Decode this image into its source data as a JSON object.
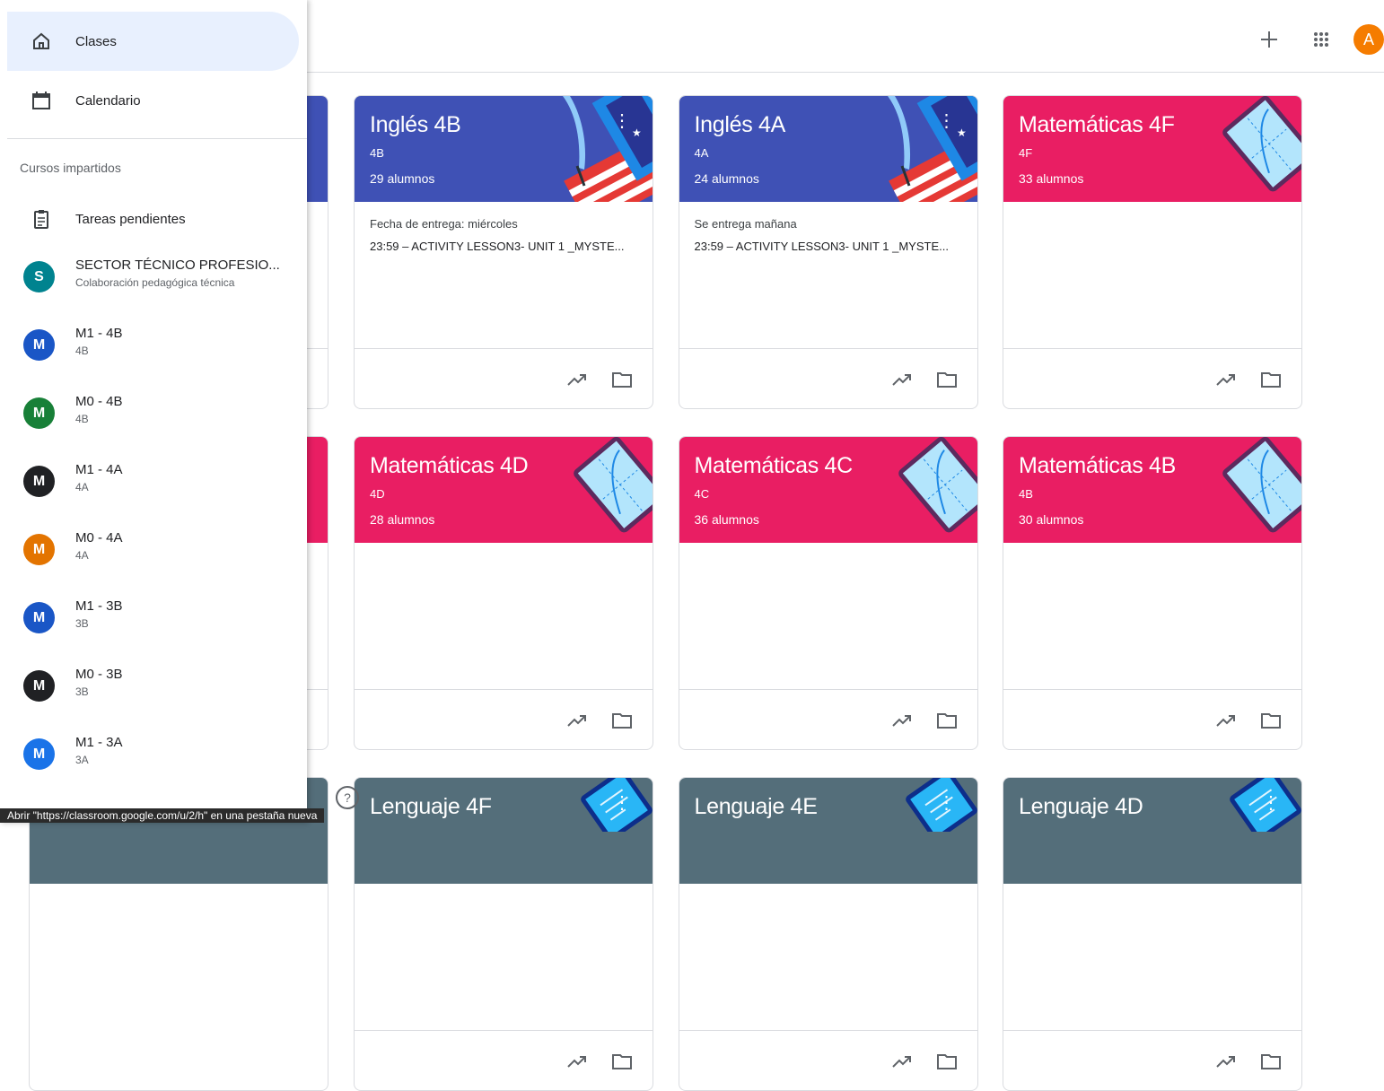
{
  "colors": {
    "indigo": "#3f51b5",
    "pink": "#e91e63",
    "slate": "#546e7a",
    "blue": "#1a56c6",
    "teal": "#00838f",
    "green": "#188038",
    "black": "#202124",
    "orange": "#e37400",
    "brightblue": "#1a73e8"
  },
  "topbar": {
    "add_icon": "plus-icon",
    "apps_icon": "apps-grid-icon",
    "avatar_letter": "A"
  },
  "drawer": {
    "nav": [
      {
        "label": "Clases",
        "icon": "home-icon"
      },
      {
        "label": "Calendario",
        "icon": "calendar-icon"
      }
    ],
    "section_label": "Cursos impartidos",
    "todo_label": "Tareas pendientes",
    "courses": [
      {
        "letter": "S",
        "name": "SECTOR TÉCNICO PROFESIO...",
        "sub": "Colaboración pedagógica técnica",
        "color": "teal"
      },
      {
        "letter": "M",
        "name": "M1 - 4B",
        "sub": "4B",
        "color": "blue"
      },
      {
        "letter": "M",
        "name": "M0 - 4B",
        "sub": "4B",
        "color": "green"
      },
      {
        "letter": "M",
        "name": "M1 - 4A",
        "sub": "4A",
        "color": "black"
      },
      {
        "letter": "M",
        "name": "M0 - 4A",
        "sub": "4A",
        "color": "orange"
      },
      {
        "letter": "M",
        "name": "M1 - 3B",
        "sub": "3B",
        "color": "blue"
      },
      {
        "letter": "M",
        "name": "M0 - 3B",
        "sub": "3B",
        "color": "black"
      },
      {
        "letter": "M",
        "name": "M1 - 3A",
        "sub": "3A",
        "color": "brightblue"
      }
    ]
  },
  "cards": [
    {
      "title": "Inglés 4B",
      "section": "4B",
      "students": "29 alumnos",
      "theme": "english",
      "due": "Fecha de entrega: miércoles",
      "task": "23:59 – ACTIVITY LESSON3- UNIT 1 _MYSTE..."
    },
    {
      "title": "Inglés 4A",
      "section": "4A",
      "students": "24 alumnos",
      "theme": "english",
      "due": "Se entrega mañana",
      "task": "23:59 – ACTIVITY LESSON3- UNIT 1 _MYSTE..."
    },
    {
      "title": "Matemáticas 4F",
      "section": "4F",
      "students": "33 alumnos",
      "theme": "math",
      "due": "",
      "task": ""
    },
    {
      "title": "Matemáticas 4D",
      "section": "4D",
      "students": "28 alumnos",
      "theme": "math",
      "due": "",
      "task": ""
    },
    {
      "title": "Matemáticas 4C",
      "section": "4C",
      "students": "36 alumnos",
      "theme": "math",
      "due": "",
      "task": ""
    },
    {
      "title": "Matemáticas 4B",
      "section": "4B",
      "students": "30 alumnos",
      "theme": "math",
      "due": "",
      "task": ""
    },
    {
      "title": "Lenguaje 4F",
      "section": "",
      "students": "",
      "theme": "lang",
      "due": "",
      "task": ""
    },
    {
      "title": "Lenguaje 4E",
      "section": "",
      "students": "",
      "theme": "lang",
      "due": "",
      "task": ""
    },
    {
      "title": "Lenguaje 4D",
      "section": "",
      "students": "",
      "theme": "lang",
      "due": "",
      "task": ""
    }
  ],
  "status_bar": "Abrir \"https://classroom.google.com/u/2/h\" en una pestaña nueva",
  "help_icon": "?"
}
